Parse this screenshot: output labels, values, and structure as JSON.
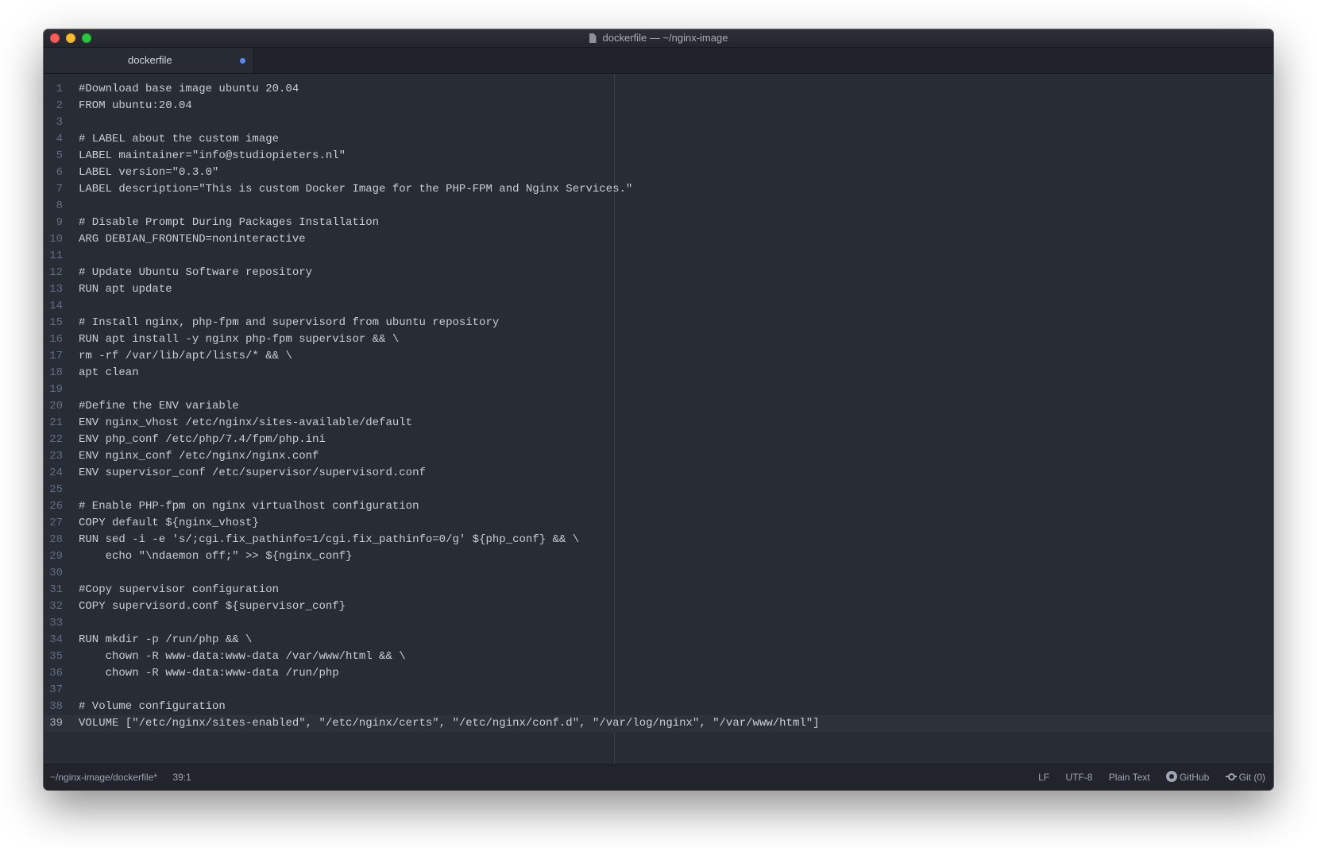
{
  "window": {
    "title": "dockerfile — ~/nginx-image"
  },
  "tab": {
    "label": "dockerfile"
  },
  "editor": {
    "current_line": 39,
    "lines": [
      "#Download base image ubuntu 20.04",
      "FROM ubuntu:20.04",
      "",
      "# LABEL about the custom image",
      "LABEL maintainer=\"info@studiopieters.nl\"",
      "LABEL version=\"0.3.0\"",
      "LABEL description=\"This is custom Docker Image for the PHP-FPM and Nginx Services.\"",
      "",
      "# Disable Prompt During Packages Installation",
      "ARG DEBIAN_FRONTEND=noninteractive",
      "",
      "# Update Ubuntu Software repository",
      "RUN apt update",
      "",
      "# Install nginx, php-fpm and supervisord from ubuntu repository",
      "RUN apt install -y nginx php-fpm supervisor && \\",
      "rm -rf /var/lib/apt/lists/* && \\",
      "apt clean",
      "",
      "#Define the ENV variable",
      "ENV nginx_vhost /etc/nginx/sites-available/default",
      "ENV php_conf /etc/php/7.4/fpm/php.ini",
      "ENV nginx_conf /etc/nginx/nginx.conf",
      "ENV supervisor_conf /etc/supervisor/supervisord.conf",
      "",
      "# Enable PHP-fpm on nginx virtualhost configuration",
      "COPY default ${nginx_vhost}",
      "RUN sed -i -e 's/;cgi.fix_pathinfo=1/cgi.fix_pathinfo=0/g' ${php_conf} && \\",
      "    echo \"\\ndaemon off;\" >> ${nginx_conf}",
      "",
      "#Copy supervisor configuration",
      "COPY supervisord.conf ${supervisor_conf}",
      "",
      "RUN mkdir -p /run/php && \\",
      "    chown -R www-data:www-data /var/www/html && \\",
      "    chown -R www-data:www-data /run/php",
      "",
      "# Volume configuration",
      "VOLUME [\"/etc/nginx/sites-enabled\", \"/etc/nginx/certs\", \"/etc/nginx/conf.d\", \"/var/log/nginx\", \"/var/www/html\"]"
    ]
  },
  "status": {
    "path": "~/nginx-image/dockerfile*",
    "cursor": "39:1",
    "line_ending": "LF",
    "encoding": "UTF-8",
    "grammar": "Plain Text",
    "github": "GitHub",
    "git": "Git (0)"
  }
}
